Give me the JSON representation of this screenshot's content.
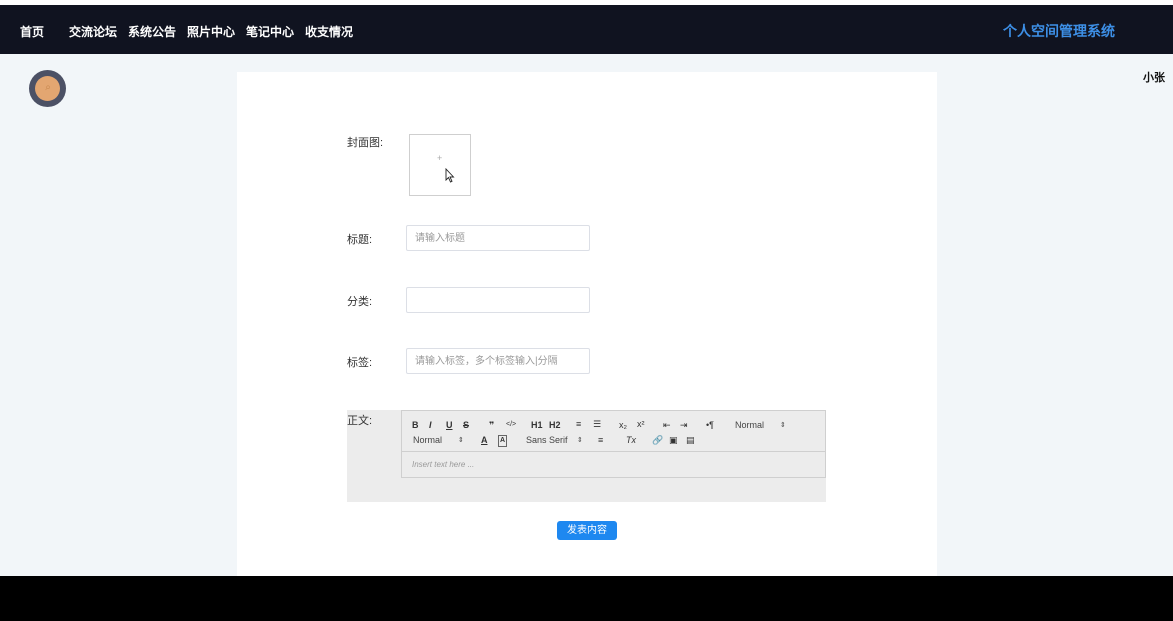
{
  "nav": {
    "items": [
      "首页",
      "交流论坛",
      "系统公告",
      "照片中心",
      "笔记中心",
      "收支情况"
    ],
    "brand": "个人空间管理系统"
  },
  "user": {
    "name": "小张"
  },
  "form": {
    "cover_label": "封面图:",
    "cover_plus": "+",
    "title_label": "标题:",
    "title_placeholder": "请输入标题",
    "category_label": "分类:",
    "category_value": "",
    "tags_label": "标签:",
    "tags_placeholder": "请输入标签，多个标签输入|分隔",
    "body_label": "正文:",
    "submit_label": "发表内容"
  },
  "editor": {
    "bold": "B",
    "italic": "I",
    "underline": "U",
    "strike": "S",
    "blockquote": "❞",
    "code": "</>",
    "h1": "H1",
    "h2": "H2",
    "ordered_list": "≡",
    "bullet_list": "☰",
    "subscript": "x₂",
    "superscript": "x²",
    "outdent": "⇤",
    "indent": "⇥",
    "direction": "•¶",
    "header_select": "Normal",
    "size_select": "Normal",
    "color": "A",
    "background": "A",
    "font_select": "Sans Serif",
    "align": "≡",
    "clean": "Tx",
    "link": "🔗",
    "image": "▣",
    "video": "▤",
    "placeholder": "Insert text here ..."
  },
  "colors": {
    "navbar": "#101320",
    "brand": "#3d8fe6",
    "submit": "#1e88f0",
    "page_bg": "#f2f6f9"
  }
}
